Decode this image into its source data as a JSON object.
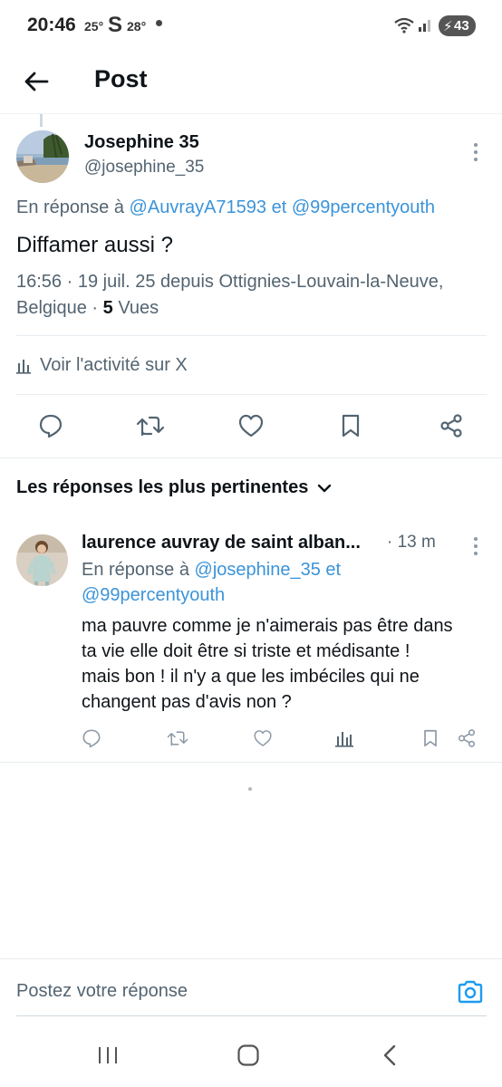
{
  "status_bar": {
    "time": "20:46",
    "temp1": "25°",
    "carrier_glyph": "S",
    "temp2": "28°",
    "battery": "43"
  },
  "header": {
    "title": "Post"
  },
  "post": {
    "author_name": "Josephine 35",
    "author_handle": "@josephine_35",
    "reply_prefix": "En réponse à",
    "reply_user1": "@AuvrayA71593",
    "reply_and": "et",
    "reply_user2": "@99percentyouth",
    "text": "Diffamer aussi ?",
    "meta_line1": "16:56 · 19 juil. 25 depuis Ottignies-Louvain-la-Neuve,",
    "meta_location2": "Belgique ·",
    "views_count": "5",
    "views_label": "Vues",
    "activity_label": "Voir l'activité sur X"
  },
  "replies_sort": {
    "label": "Les réponses les plus pertinentes"
  },
  "reply": {
    "author_name": "laurence auvray de saint alban...",
    "time": "· 13 m",
    "reply_prefix": "En réponse à",
    "reply_user1": "@josephine_35",
    "reply_and": "et",
    "reply_user2": "@99percentyouth",
    "text_lines": [
      "ma pauvre comme je n'aimerais pas être dans",
      "ta vie elle doit être si triste et médisante !",
      "mais bon ! il n'y a que les imbéciles qui ne",
      "changent pas d'avis non ?"
    ]
  },
  "compose": {
    "placeholder": "Postez votre réponse"
  },
  "colors": {
    "link": "#3b94d9",
    "secondary_text": "#536471",
    "primary_text": "#0f1419"
  },
  "icons": [
    "back-arrow-icon",
    "more-vertical-icon",
    "analytics-icon",
    "reply-icon",
    "retweet-icon",
    "like-icon",
    "bookmark-icon",
    "share-icon",
    "chevron-down-icon",
    "camera-icon"
  ]
}
